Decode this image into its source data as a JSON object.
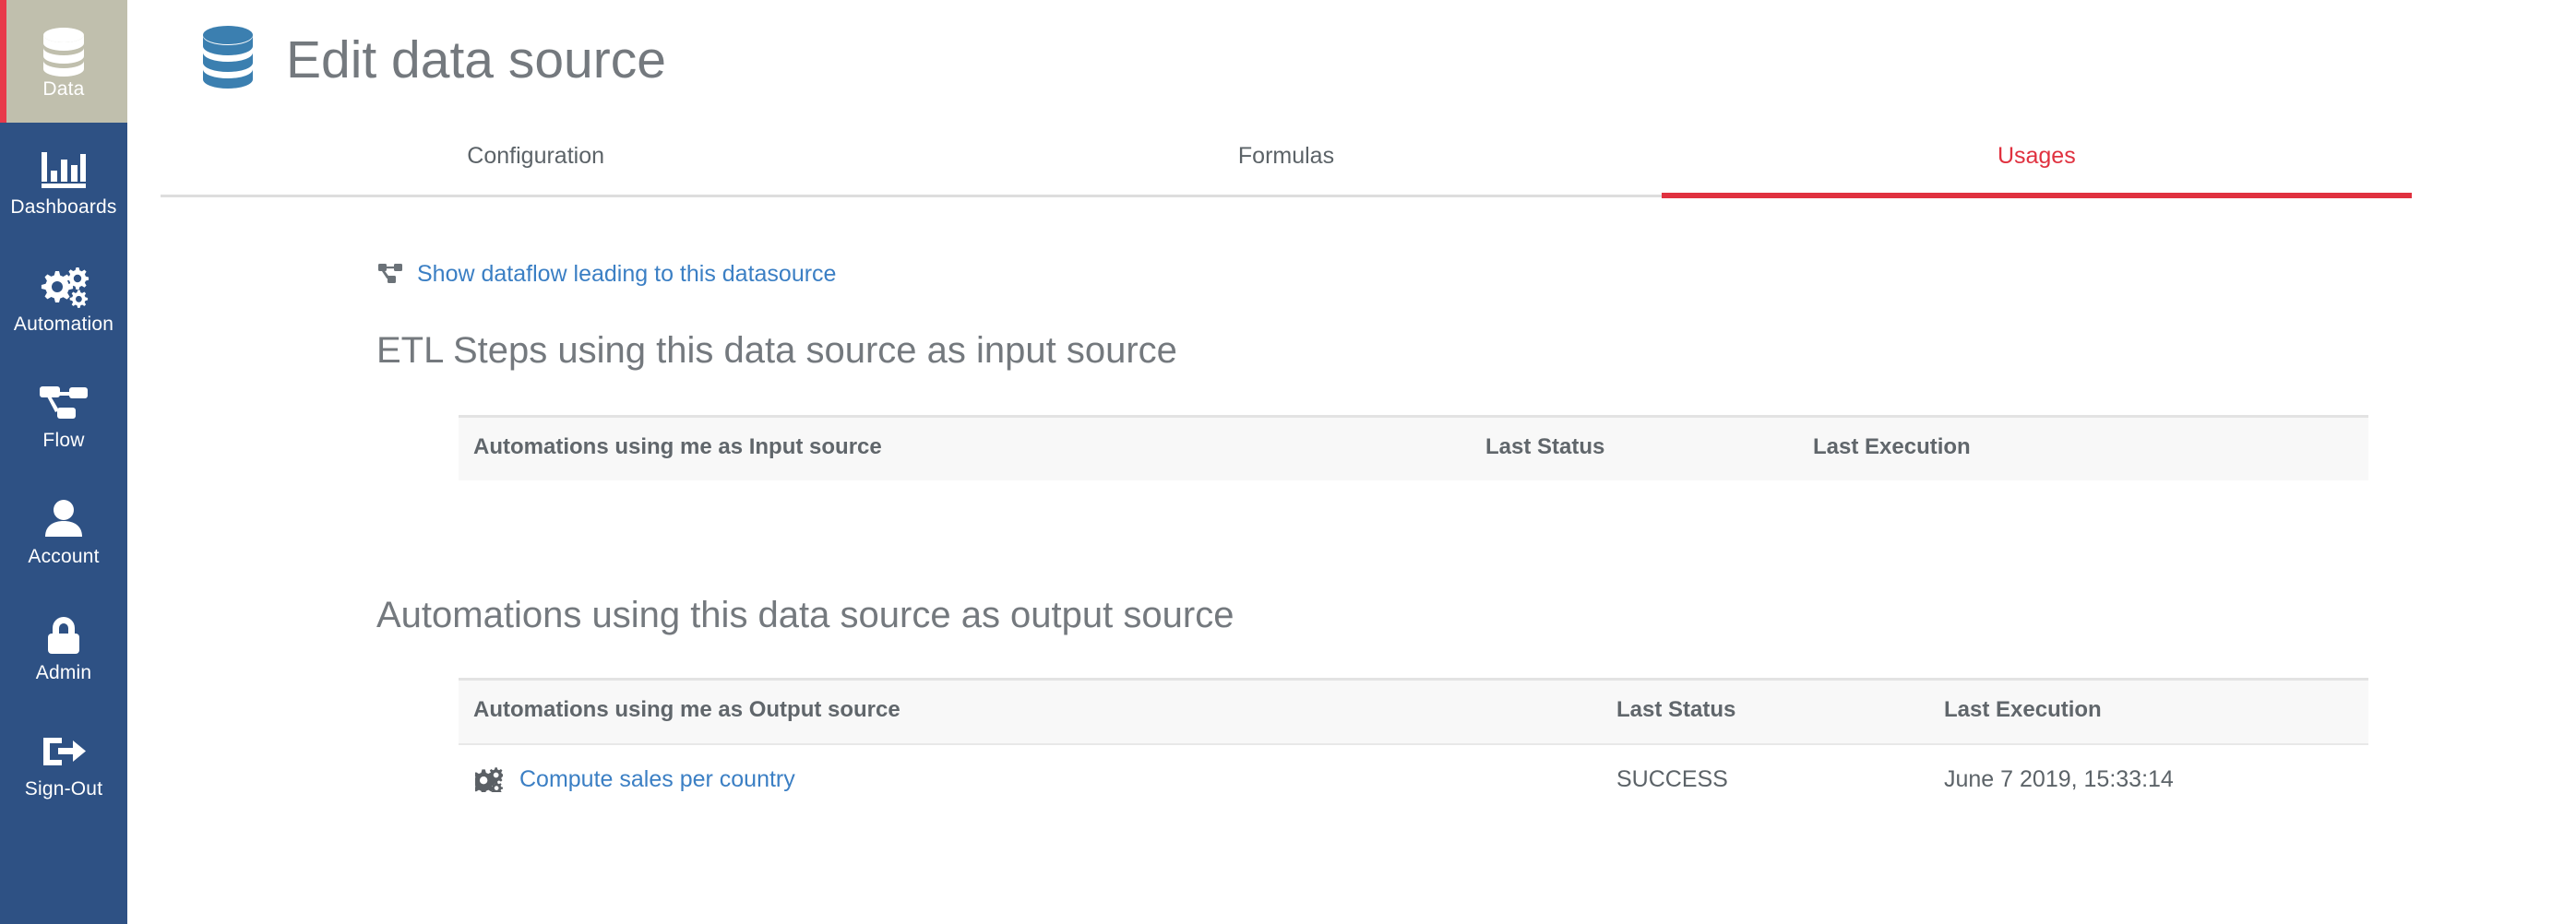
{
  "sidebar": {
    "items": [
      {
        "id": "data",
        "label": "Data",
        "icon": "database-icon",
        "active": true
      },
      {
        "id": "dashboards",
        "label": "Dashboards",
        "icon": "bar-chart-icon",
        "active": false
      },
      {
        "id": "automation",
        "label": "Automation",
        "icon": "gears-icon",
        "active": false
      },
      {
        "id": "flow",
        "label": "Flow",
        "icon": "flow-icon",
        "active": false
      },
      {
        "id": "account",
        "label": "Account",
        "icon": "user-icon",
        "active": false
      },
      {
        "id": "admin",
        "label": "Admin",
        "icon": "lock-icon",
        "active": false
      },
      {
        "id": "signout",
        "label": "Sign-Out",
        "icon": "sign-out-icon",
        "active": false
      }
    ],
    "colors": {
      "background": "#2e5184",
      "active_background": "#c0bfad",
      "active_accent": "#e8394a",
      "label": "#ffffff"
    }
  },
  "header": {
    "title": "Edit data source",
    "icon": "database-icon",
    "title_color": "#74797e",
    "icon_color": "#3b7fb0"
  },
  "tabs": {
    "items": [
      {
        "label": "Configuration",
        "active": false
      },
      {
        "label": "Formulas",
        "active": false
      },
      {
        "label": "Usages",
        "active": true
      }
    ],
    "active_color": "#e0313f"
  },
  "main": {
    "dataflow_link": {
      "label": "Show dataflow leading to this datasource",
      "icon": "sitemap-icon",
      "color": "#3b7fc4"
    },
    "input_section": {
      "heading": "ETL Steps using this data source as input source",
      "columns": [
        "Automations using me as Input source",
        "Last Status",
        "Last Execution"
      ],
      "rows": []
    },
    "output_section": {
      "heading": "Automations using this data source as output source",
      "columns": [
        "Automations using me as Output source",
        "Last Status",
        "Last Execution"
      ],
      "rows": [
        {
          "icon": "gears-icon",
          "name": "Compute sales per country",
          "last_status": "SUCCESS",
          "last_execution": "June 7 2019, 15:33:14"
        }
      ]
    }
  }
}
